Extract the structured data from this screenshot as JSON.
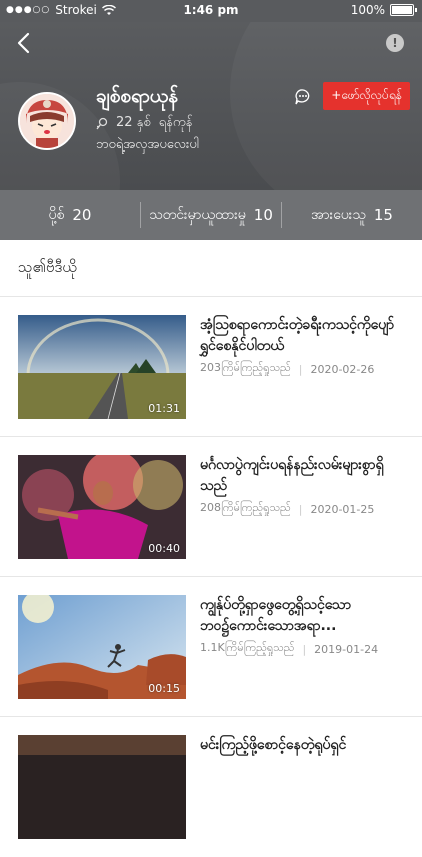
{
  "status_bar": {
    "carrier": "Strokei",
    "time": "1:46 pm",
    "battery": "100%"
  },
  "profile": {
    "name": "ချစ်စရာယုန်",
    "age": "22 နှစ်",
    "city": "ရန်ကုန်",
    "bio": "ဘဝရဲ့အလှအပလေးပါ",
    "follow_label": "+ဖော်လိုလုပ်ရန်"
  },
  "stats": [
    {
      "label": "ပို့စ်",
      "value": "20"
    },
    {
      "label": "သတင်းမှာယူထားမှု",
      "value": "10"
    },
    {
      "label": "အားပေးသူ",
      "value": "15"
    }
  ],
  "section": {
    "title": "သူ၏ဗီဒီယို"
  },
  "videos": [
    {
      "title": "အံ့ဩစရာကောင်းတဲ့ခရီးကသင့်ကိုပျော်ရွှင်စေနိုင်ပါတယ်",
      "views": "203ကြိမ်ကြည့်ရှုသည်",
      "date": "2020-02-26",
      "duration": "01:31"
    },
    {
      "title": "မင်္ဂလာပွဲကျင်းပရန်နည်းလမ်းများစွာရှိသည်",
      "views": "208ကြိမ်ကြည့်ရှုသည်",
      "date": "2020-01-25",
      "duration": "00:40"
    },
    {
      "title": "ကျွန်ုပ်တို့ရှာဖွေတွေ့ရှိသင့်သောဘဝ၌ကောင်းသောအရာ...",
      "views": "1.1Kကြိမ်ကြည့်ရှုသည်",
      "date": "2019-01-24",
      "duration": "00:15"
    },
    {
      "title": "မင်းကြည့်ဖို့စောင့်နေတဲ့ရုပ်ရှင်",
      "views": "",
      "date": "",
      "duration": ""
    }
  ],
  "colors": {
    "accent": "#e5322d",
    "header": "#545659",
    "stats_bar": "#6f7174"
  }
}
